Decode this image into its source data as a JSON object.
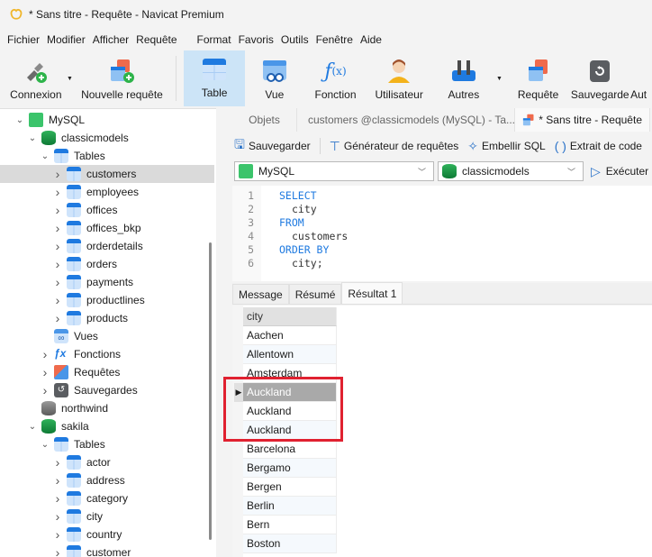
{
  "window": {
    "title": "* Sans titre - Requête - Navicat Premium",
    "app_icon": "navicat-logo-icon"
  },
  "menu": [
    "Fichier",
    "Modifier",
    "Afficher",
    "Requête",
    "Format",
    "Favoris",
    "Outils",
    "Fenêtre",
    "Aide"
  ],
  "toolbar": {
    "connexion": "Connexion",
    "nouvelle_requete": "Nouvelle requête",
    "table": "Table",
    "vue": "Vue",
    "fonction": "Fonction",
    "utilisateur": "Utilisateur",
    "autres": "Autres",
    "requete": "Requête",
    "sauvegarde": "Sauvegarde",
    "auto": "Aut"
  },
  "sidebar": {
    "items": [
      {
        "label": "MySQL",
        "level": 0,
        "expanded": true,
        "icon": "mysql-icon"
      },
      {
        "label": "classicmodels",
        "level": 1,
        "expanded": true,
        "icon": "database-icon"
      },
      {
        "label": "Tables",
        "level": 2,
        "expanded": true,
        "icon": "table-icon"
      },
      {
        "label": "customers",
        "level": 3,
        "icon": "table-icon",
        "selected": true
      },
      {
        "label": "employees",
        "level": 3,
        "icon": "table-icon"
      },
      {
        "label": "offices",
        "level": 3,
        "icon": "table-icon"
      },
      {
        "label": "offices_bkp",
        "level": 3,
        "icon": "table-icon"
      },
      {
        "label": "orderdetails",
        "level": 3,
        "icon": "table-icon"
      },
      {
        "label": "orders",
        "level": 3,
        "icon": "table-icon"
      },
      {
        "label": "payments",
        "level": 3,
        "icon": "table-icon"
      },
      {
        "label": "productlines",
        "level": 3,
        "icon": "table-icon"
      },
      {
        "label": "products",
        "level": 3,
        "icon": "table-icon"
      },
      {
        "label": "Vues",
        "level": 2,
        "icon": "view-icon"
      },
      {
        "label": "Fonctions",
        "level": 2,
        "icon": "function-icon"
      },
      {
        "label": "Requêtes",
        "level": 2,
        "icon": "query-icon"
      },
      {
        "label": "Sauvegardes",
        "level": 2,
        "icon": "backup-icon"
      },
      {
        "label": "northwind",
        "level": 1,
        "icon": "database-icon"
      },
      {
        "label": "sakila",
        "level": 1,
        "expanded": true,
        "icon": "database-icon"
      },
      {
        "label": "Tables",
        "level": 2,
        "expanded": true,
        "icon": "table-icon"
      },
      {
        "label": "actor",
        "level": 3,
        "icon": "table-icon"
      },
      {
        "label": "address",
        "level": 3,
        "icon": "table-icon"
      },
      {
        "label": "category",
        "level": 3,
        "icon": "table-icon"
      },
      {
        "label": "city",
        "level": 3,
        "icon": "table-icon"
      },
      {
        "label": "country",
        "level": 3,
        "icon": "table-icon"
      },
      {
        "label": "customer",
        "level": 3,
        "icon": "table-icon"
      }
    ]
  },
  "tabs": {
    "objets": "Objets",
    "customers": "customers @classicmodels (MySQL) - Ta...",
    "query": "* Sans titre - Requête"
  },
  "query_toolbar": {
    "save": "Sauvegarder",
    "builder": "Générateur de requêtes",
    "beautify": "Embellir SQL",
    "snippet": "Extrait de code"
  },
  "selectors": {
    "connection": "MySQL",
    "database": "classicmodels",
    "execute": "Exécuter"
  },
  "editor": {
    "lines": [
      {
        "n": "1",
        "text": "SELECT",
        "kw": true,
        "indent": false
      },
      {
        "n": "2",
        "text": "city",
        "kw": false,
        "indent": true
      },
      {
        "n": "3",
        "text": "FROM",
        "kw": true,
        "indent": false
      },
      {
        "n": "4",
        "text": "customers",
        "kw": false,
        "indent": true
      },
      {
        "n": "5",
        "text": "ORDER BY",
        "kw": true,
        "indent": false
      },
      {
        "n": "6",
        "text": "city;",
        "kw": false,
        "indent": true
      }
    ]
  },
  "result_tabs": [
    "Message",
    "Résumé",
    "Résultat 1"
  ],
  "result": {
    "column": "city",
    "rows": [
      "Aachen",
      "Allentown",
      "Amsterdam",
      "Auckland",
      "Auckland",
      "Auckland",
      "Barcelona",
      "Bergamo",
      "Bergen",
      "Berlin",
      "Bern",
      "Boston"
    ],
    "selected_index": 3,
    "highlighted_rows": [
      3,
      4,
      5
    ]
  },
  "colors": {
    "highlight_box": "#e02130",
    "accent": "#1f7ae0",
    "selected_row": "#a9a9a9"
  }
}
